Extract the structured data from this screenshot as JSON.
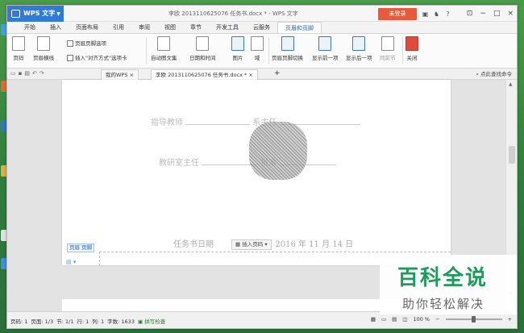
{
  "app": {
    "name": "WPS 文字",
    "window_title": "李欧 2013110625076 任务书.docx * - WPS 文字",
    "login_label": "未登录"
  },
  "ribbon_tabs": [
    "开始",
    "插入",
    "页面布局",
    "引用",
    "审阅",
    "视图",
    "章节",
    "开发工具",
    "云服务",
    "页眉和页脚"
  ],
  "active_tab": "页眉和页脚",
  "ribbon": {
    "page_number": "页码",
    "header_line": "页眉横线",
    "header_footer_options": "页眉页脚选项",
    "insert_align_tab": "插入\"对齐方式\"选项卡",
    "auto_text": "自动图文集",
    "date_time": "日期和时间",
    "picture": "图片",
    "domain": "域",
    "switch_header_footer": "页眉页脚切换",
    "show_previous": "显示前一项",
    "show_next": "显示后一项",
    "same_as_previous": "同前节",
    "close": "关闭"
  },
  "doc_tabs": {
    "my_wps": "我的WPS",
    "current_doc": "李欧 2013110625076 任务书.docx *",
    "search_cmd": "点此查找命令"
  },
  "document": {
    "line1_label": "指导教师",
    "line1_right": "系主任",
    "line2_label": "教研室主任",
    "line2_right": "批准",
    "date_label": "任务书日期",
    "date_value": "2016 年 11 月 14 日",
    "footer_tag": "页脚",
    "header_tag": "页眉",
    "insert_page_number": "插入页码"
  },
  "status": {
    "page": "页码: 1",
    "pages": "页面: 1/3",
    "section": "节: 1/1",
    "row": "行: 1",
    "col": "列: 1",
    "words": "字数: 1633",
    "spellcheck": "拼写检查",
    "zoom": "100 %",
    "zoom_level": 0.5
  },
  "watermark": {
    "title": "百科全说",
    "subtitle": "助你轻松解决"
  },
  "colors": {
    "accent": "#2f7bd6",
    "login": "#e55b3b",
    "watermark_green": "#1f9a5c"
  }
}
